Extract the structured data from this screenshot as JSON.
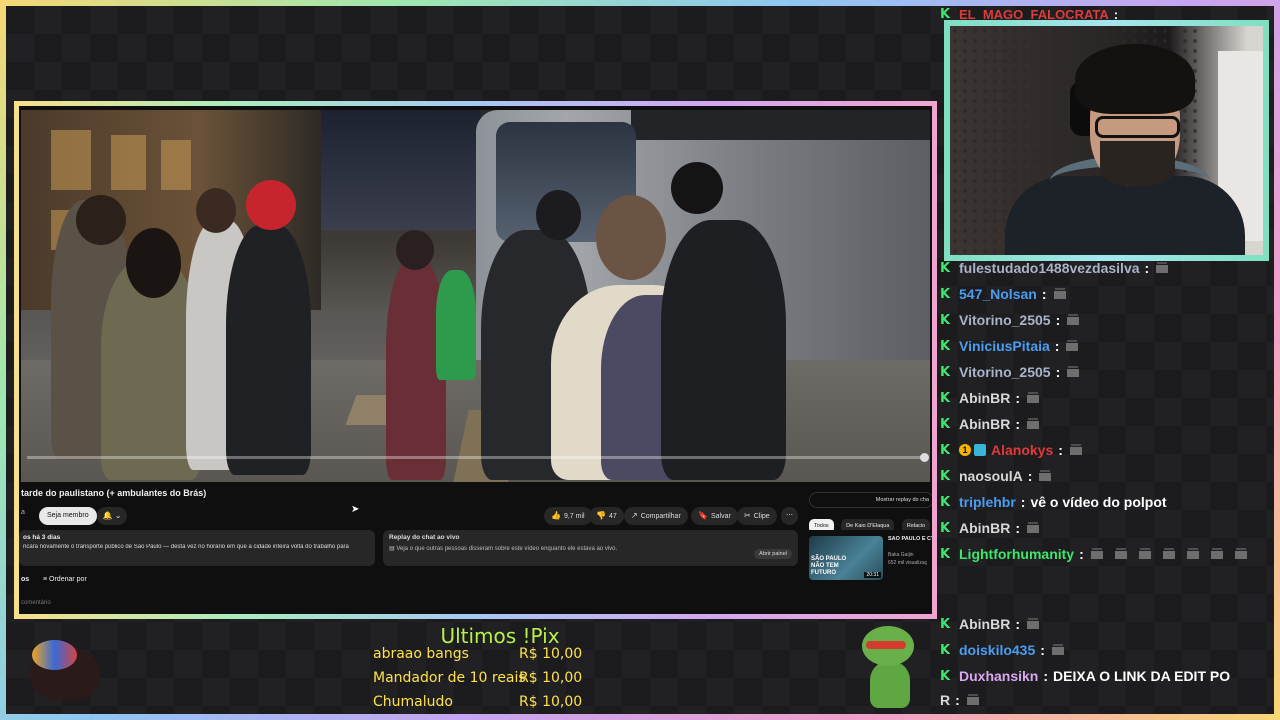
{
  "video": {
    "title": "tarde do paulistano (+ ambulantes do Brás)",
    "channel_short": "a",
    "member_button": "Seja membro",
    "bell": "🔔 ⌄",
    "likes": "9,7 mil",
    "dislikes": "47",
    "share": "Compartilhar",
    "save": "Salvar",
    "clip": "Clipe",
    "more": "⋯",
    "description_meta": "os  há 3 dias",
    "description_text": "ncara novamente o transporte público de São Paulo — desta vez no horário em que a cidade inteira volta do trabalho para",
    "chat_replay_title": "Replay do chat ao vivo",
    "chat_replay_desc": "Veja o que outras pessoas disseram sobre este vídeo enquanto ele estava ao vivo.",
    "chat_replay_open": "Abrir painel",
    "comments_label": "os",
    "sort_by": "Ordenar por",
    "add_comment": "comentário",
    "show_chat_replay": "Mostrar replay do cha",
    "chips": [
      "Todos",
      "De Kaio D'Elaqua",
      "Relacio"
    ],
    "rec": {
      "thumb_caption": "SÃO PAULO NÃO TEM FUTURO",
      "duration": "20:31",
      "title": "SÃO PAULO É CYBERPUNK D",
      "channel": "Baka Gaijin",
      "views": "652 mil visualizaç"
    }
  },
  "chat": {
    "top": {
      "user": "EL_MAGO_FALOCRATA",
      "color": "#e03a3a"
    },
    "lines": [
      {
        "user": "fulestudado1488vezdasilva",
        "color": "#a9b4c8",
        "msg": "",
        "emotes": 1
      },
      {
        "user": "547_Nolsan",
        "color": "#4a9ef2",
        "msg": "",
        "emotes": 1
      },
      {
        "user": "Vitorino_2505",
        "color": "#a9b4c8",
        "msg": "",
        "emotes": 1
      },
      {
        "user": "ViniciusPitaia",
        "color": "#4a9ef2",
        "msg": "",
        "emotes": 1
      },
      {
        "user": "Vitorino_2505",
        "color": "#a9b4c8",
        "msg": "",
        "emotes": 1
      },
      {
        "user": "AbinBR",
        "color": "#d8d8d8",
        "msg": "",
        "emotes": 1
      },
      {
        "user": "AbinBR",
        "color": "#d8d8d8",
        "msg": "",
        "emotes": 1
      },
      {
        "user": "Alanokys",
        "color": "#e03a3a",
        "msg": "",
        "emotes": 1,
        "badges": true
      },
      {
        "user": "naosoulA",
        "color": "#d8d8d8",
        "msg": "",
        "emotes": 1
      },
      {
        "user": "triplehbr",
        "color": "#4a9ef2",
        "msg": "vê o vídeo do polpot",
        "emotes": 0
      },
      {
        "user": "AbinBR",
        "color": "#d8d8d8",
        "msg": "",
        "emotes": 1
      },
      {
        "user": "Lightforhumanity",
        "color": "#3ee66b",
        "msg": "",
        "emotes": 7
      },
      {
        "user": "AbinBR",
        "color": "#d8d8d8",
        "msg": "",
        "emotes": 1
      },
      {
        "user": "doiskilo435",
        "color": "#4a9ef2",
        "msg": "",
        "emotes": 1
      },
      {
        "user": "Duxhansikn",
        "color": "#d8a8f0",
        "msg": "DEIXA O LINK DA EDIT PO",
        "emotes": 0
      }
    ],
    "tail": "R"
  },
  "pix": {
    "title": "Ultimos !Pix",
    "rows": [
      {
        "name": "abraao bangs",
        "value": "R$ 10,00"
      },
      {
        "name": "Mandador de 10 reais",
        "value": "R$ 10,00"
      },
      {
        "name": "Chumaludo",
        "value": "R$ 10,00"
      }
    ]
  },
  "colors": {
    "pix_title": "#b8f04a",
    "pix_rows": "#ffe14a",
    "chat_badge": "#3ee66b"
  }
}
